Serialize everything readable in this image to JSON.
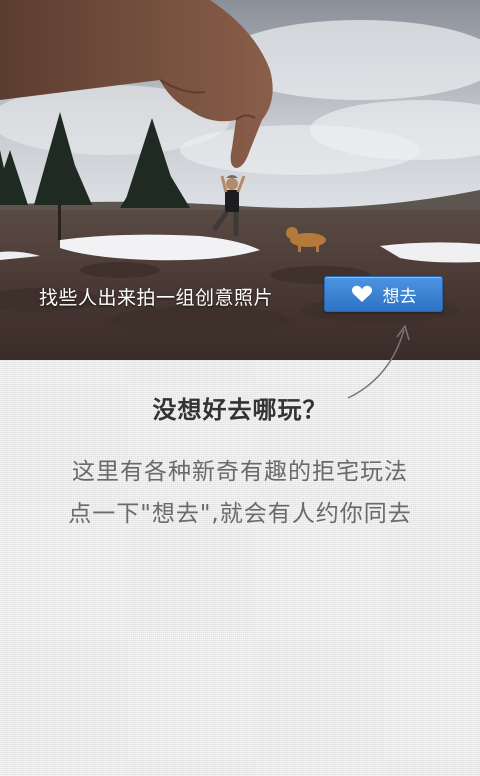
{
  "hero": {
    "caption": "找些人出来拍一组创意照片",
    "photo_icon": "photo-background"
  },
  "want_button": {
    "label": "想去",
    "icon": "heart-icon",
    "color": "#3a7fd0"
  },
  "promo": {
    "title": "没想好去哪玩？",
    "line1": "这里有各种新奇有趣的拒宅玩法",
    "line2": "点一下\"想去\",就会有人约你同去"
  },
  "colors": {
    "background": "#e9e9e9",
    "title_text": "#333333",
    "body_text": "#6a6a6a"
  }
}
